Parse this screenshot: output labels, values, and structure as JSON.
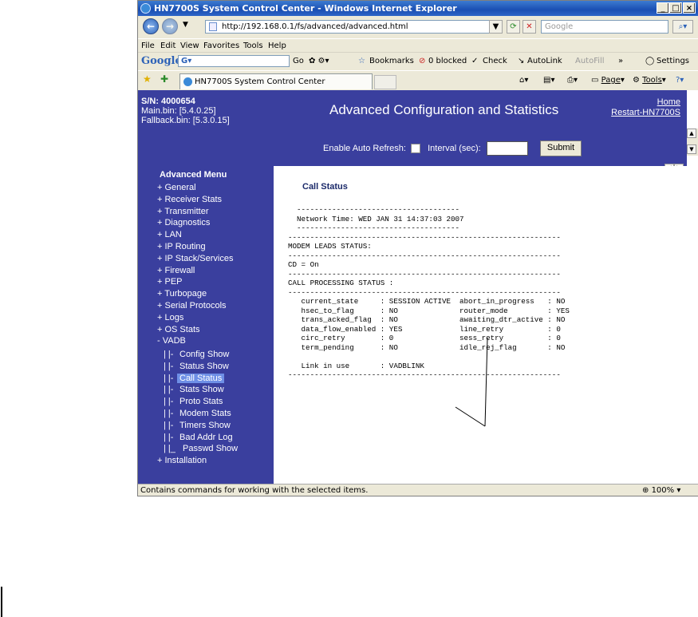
{
  "window": {
    "title": "HN7700S System Control Center - Windows Internet Explorer",
    "min": "_",
    "max": "□",
    "close": "×"
  },
  "address": {
    "url": "http://192.168.0.1/fs/advanced/advanced.html",
    "search_placeholder": "Google"
  },
  "menu": [
    "File",
    "Edit",
    "View",
    "Favorites",
    "Tools",
    "Help"
  ],
  "gtoolbar": {
    "logo": "Google",
    "box": "G",
    "go": "Go",
    "bookmarks": "Bookmarks",
    "blocked": "0 blocked",
    "check": "Check",
    "autolink": "AutoLink",
    "autofill": "AutoFill",
    "more": "»",
    "settings": "Settings"
  },
  "tabbar": {
    "tab_title": "HN7700S System Control Center",
    "page": "Page",
    "tools": "Tools"
  },
  "header": {
    "sn": "S/N: 4000654",
    "main_bin": "Main.bin: [5.4.0.25]",
    "fallback_bin": "Fallback.bin: [5.3.0.15]",
    "title": "Advanced Configuration and Statistics",
    "home": "Home",
    "restart": "Restart-HN7700S",
    "auto_refresh": "Enable Auto Refresh:",
    "interval": "Interval (sec):",
    "submit": "Submit"
  },
  "sidebar": {
    "title": "Advanced Menu",
    "items": [
      "+ General",
      "+ Receiver Stats",
      "+ Transmitter",
      "+ Diagnostics",
      "+ LAN",
      "+ IP Routing",
      "+ IP Stack/Services",
      "+ Firewall",
      "+ PEP",
      "+ Turbopage",
      "+ Serial Protocols",
      "+ Logs",
      "+ OS Stats",
      "- VADB"
    ],
    "sub_items": [
      {
        "prefix": "| |-",
        "label": "Config Show"
      },
      {
        "prefix": "| |-",
        "label": "Status Show"
      },
      {
        "prefix": "| |-",
        "label": "Call Status"
      },
      {
        "prefix": "| |-",
        "label": "Stats Show"
      },
      {
        "prefix": "| |-",
        "label": "Proto Stats"
      },
      {
        "prefix": "| |-",
        "label": "Modem Stats"
      },
      {
        "prefix": "| |-",
        "label": "Timers Show"
      },
      {
        "prefix": "| |-",
        "label": "Bad Addr Log"
      },
      {
        "prefix": "| |_",
        "label": "Passwd Show"
      }
    ],
    "selected": "Call Status",
    "last": "+ Installation"
  },
  "main": {
    "heading": "Call Status",
    "network_time": "Network Time: WED JAN 31 14:37:03 2007",
    "modem_leads": "MODEM LEADS STATUS:",
    "cd": "CD = On",
    "call_processing": "CALL PROCESSING STATUS :",
    "rows": [
      [
        "current_state",
        "SESSION ACTIVE",
        "abort_in_progress",
        "NO"
      ],
      [
        "hsec_to_flag",
        "NO",
        "router_mode",
        "YES"
      ],
      [
        "trans_acked_flag",
        "NO",
        "awaiting_dtr_active",
        "NO"
      ],
      [
        "data_flow_enabled",
        "YES",
        "line_retry",
        "0"
      ],
      [
        "circ_retry",
        "0",
        "sess_retry",
        "0"
      ],
      [
        "term_pending",
        "NO",
        "idle_rej_flag",
        "NO"
      ]
    ],
    "link_label": "Link in use",
    "link_value": "VADBLINK"
  },
  "statusbar": {
    "text": "Contains commands for working with the selected items.",
    "zoom": "100%"
  }
}
